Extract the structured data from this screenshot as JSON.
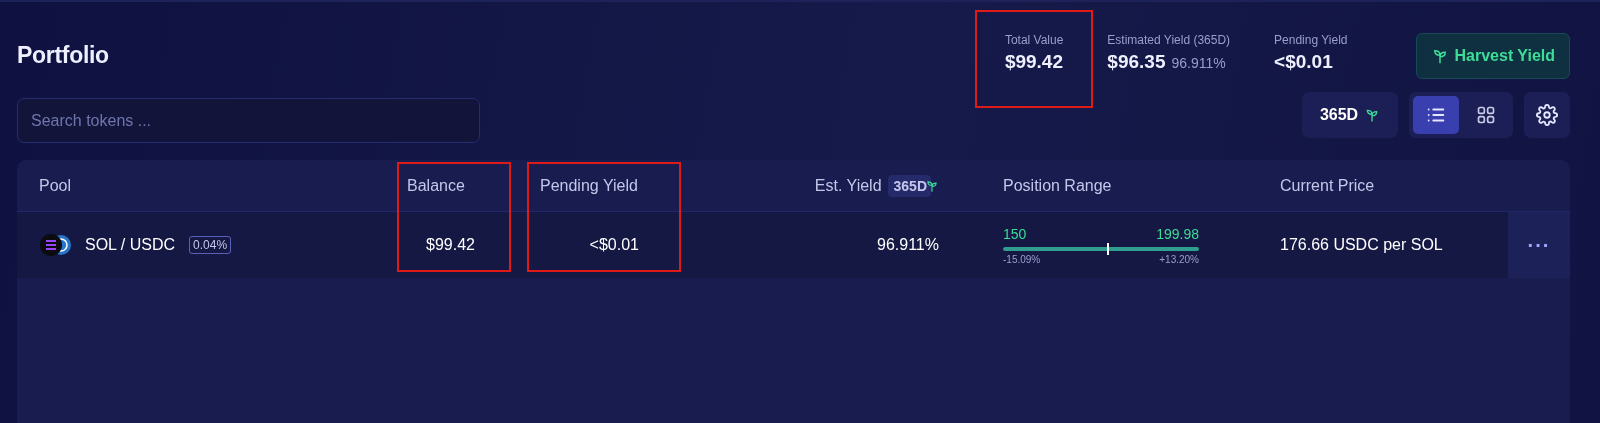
{
  "title": "Portfolio",
  "search": {
    "placeholder": "Search tokens ..."
  },
  "stats": [
    {
      "label": "Total Value",
      "value": "$99.42",
      "highlighted": true
    },
    {
      "label": "Estimated Yield (365D)",
      "value": "$96.35",
      "sub": "96.911%",
      "highlighted": false
    },
    {
      "label": "Pending Yield",
      "value": "<$0.01",
      "highlighted": false
    }
  ],
  "harvest_button": "Harvest Yield",
  "period_button": "365D",
  "view_toggle": [
    {
      "kind": "list",
      "selected": true
    },
    {
      "kind": "grid",
      "selected": false
    }
  ],
  "table": {
    "columns": [
      {
        "label": "Pool",
        "highlighted": false
      },
      {
        "label": "Balance",
        "highlighted": true
      },
      {
        "label": "Pending Yield",
        "highlighted": true
      },
      {
        "label": "Est. Yield",
        "badge": "365D",
        "highlighted": false
      },
      {
        "label": "Position Range",
        "highlighted": false
      },
      {
        "label": "Current Price",
        "highlighted": false
      }
    ],
    "rows": [
      {
        "pool": "SOL / USDC",
        "fee": "0.04%",
        "balance": "$99.42",
        "pending": "<$0.01",
        "est_yield": "96.911%",
        "range": {
          "low": "150",
          "high": "199.98",
          "low_pct": "-15.09%",
          "high_pct": "+13.20%",
          "level": 0.53
        },
        "price": "176.66 USDC per SOL",
        "menu": "···"
      }
    ]
  }
}
